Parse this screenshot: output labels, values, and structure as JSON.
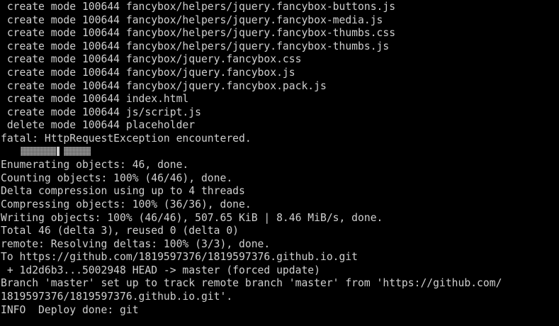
{
  "terminal": {
    "lines": [
      " create mode 100644 fancybox/helpers/jquery.fancybox-buttons.js",
      " create mode 100644 fancybox/helpers/jquery.fancybox-media.js",
      " create mode 100644 fancybox/helpers/jquery.fancybox-thumbs.css",
      " create mode 100644 fancybox/helpers/jquery.fancybox-thumbs.js",
      " create mode 100644 fancybox/jquery.fancybox.css",
      " create mode 100644 fancybox/jquery.fancybox.js",
      " create mode 100644 fancybox/jquery.fancybox.pack.js",
      " create mode 100644 index.html",
      " create mode 100644 js/script.js",
      " delete mode 100644 placeholder",
      "fatal: HttpRequestException encountered.",
      "",
      "Enumerating objects: 46, done.",
      "Counting objects: 100% (46/46), done.",
      "Delta compression using up to 4 threads",
      "Compressing objects: 100% (36/36), done.",
      "Writing objects: 100% (46/46), 507.65 KiB | 8.46 MiB/s, done.",
      "Total 46 (delta 3), reused 0 (delta 0)",
      "remote: Resolving deltas: 100% (3/3), done.",
      "To https://github.com/1819597376/1819597376.github.io.git",
      " + 1d2d6b3...5002948 HEAD -> master (forced update)",
      "Branch 'master' set up to track remote branch 'master' from 'https://github.com/",
      "1819597376/1819597376.github.io.git'.",
      "INFO  Deploy done: git"
    ]
  },
  "colors": {
    "background": "#000000",
    "text": "#cfcfcf"
  }
}
